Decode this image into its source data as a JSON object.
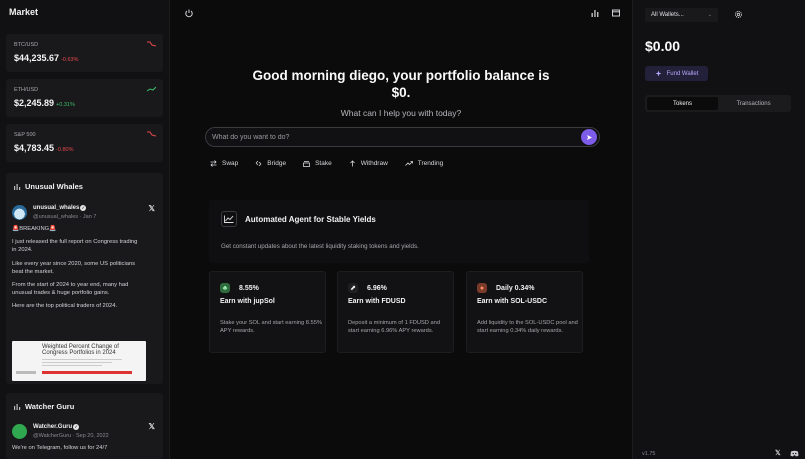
{
  "sidebar": {
    "title": "Market",
    "markets": [
      {
        "symbol": "BTC/USD",
        "price": "$44,235.67",
        "change": "-0.63%",
        "direction": "down"
      },
      {
        "symbol": "ETH/USD",
        "price": "$2,245.89",
        "change": "+0.31%",
        "direction": "up"
      },
      {
        "symbol": "S&P 500",
        "price": "$4,783.45",
        "change": "-0.80%",
        "direction": "down"
      }
    ],
    "feeds": [
      {
        "title": "Unusual Whales",
        "name": "unusual_whales",
        "handle": "@unusual_whales · Jan 7",
        "paragraphs": [
          "🚨BREAKING🚨",
          "I just released the full report on Congress trading in 2024.",
          "Like every year since 2020, some US politicians beat the market.",
          "From the start of 2024 to year end, many had unusual trades & huge portfolio gains.",
          "Here are the top political traders of 2024."
        ],
        "image_title_1": "Weighted Percent Change of",
        "image_title_2": "Congress Portfolios in 2024"
      },
      {
        "title": "Watcher Guru",
        "name": "Watcher.Guru",
        "handle": "@WatcherGuru · Sep 20, 2022",
        "paragraphs": [
          "We're on Telegram, follow us for 24/7"
        ]
      }
    ]
  },
  "center": {
    "greeting": "Good morning diego, your portfolio balance is $0.",
    "subtitle": "What can I help you with today?",
    "prompt_placeholder": "What do you want to do?",
    "actions": [
      {
        "label": "Swap",
        "icon": "swap-icon"
      },
      {
        "label": "Bridge",
        "icon": "bridge-icon"
      },
      {
        "label": "Stake",
        "icon": "stake-icon"
      },
      {
        "label": "Withdraw",
        "icon": "withdraw-icon"
      },
      {
        "label": "Trending",
        "icon": "trending-icon"
      }
    ],
    "agent": {
      "title": "Automated Agent for Stable Yields",
      "description": "Get constant updates about the latest liquidity staking tokens and yields."
    },
    "yields": [
      {
        "rate": "8.55%",
        "name": "Earn with jupSol",
        "description": "Stake your SOL and start earning 8.55% APY rewards.",
        "icon_color": "#2f6b3f",
        "icon_glyph": "♣"
      },
      {
        "rate": "6.96%",
        "name": "Earn with FDUSD",
        "description": "Deposit a minimum of 1 FDUSD and start earning 6.96% APY rewards.",
        "icon_color": "#1f1f22",
        "icon_glyph": "⬈"
      },
      {
        "rate": "Daily 0.34%",
        "name": "Earn with SOL-USDC",
        "description": "Add liquidity to the SOL-USDC pool and start earning 0.34% daily rewards.",
        "icon_color": "#7a3a2a",
        "icon_glyph": "●"
      }
    ]
  },
  "right": {
    "wallet_select": "All Wallets...",
    "balance": "$0.00",
    "fund_label": "Fund Wallet",
    "tabs": [
      "Tokens",
      "Transactions"
    ],
    "version": "v1.75"
  },
  "colors": {
    "accent": "#7c5ce8",
    "negative": "#e5484d",
    "positive": "#3fbf6b"
  }
}
